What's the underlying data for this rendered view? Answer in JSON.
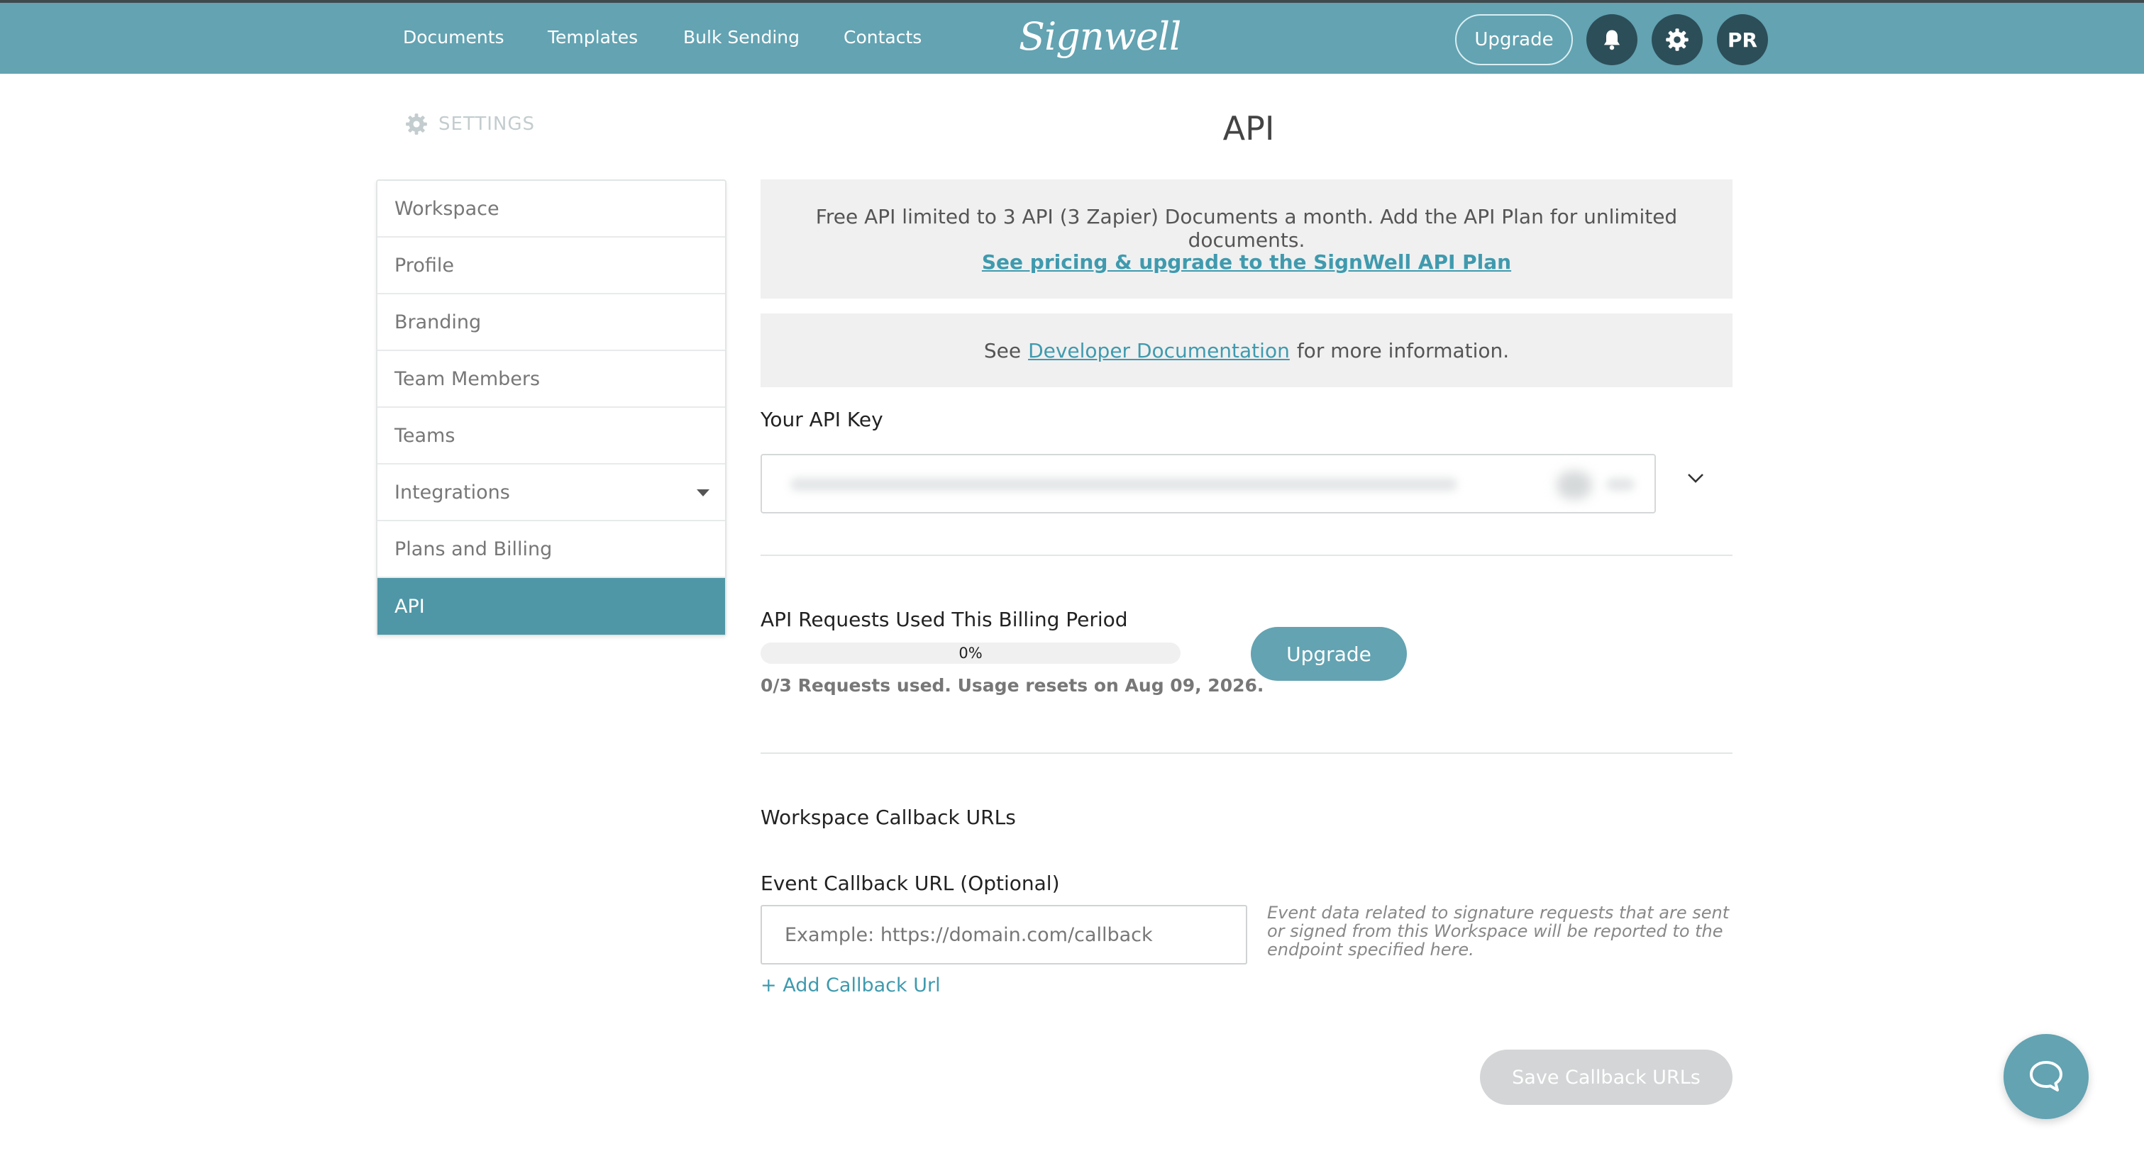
{
  "nav": {
    "links": [
      "Documents",
      "Templates",
      "Bulk Sending",
      "Contacts"
    ],
    "logo": "Signwell",
    "upgrade_label": "Upgrade",
    "avatar_initials": "PR"
  },
  "settings": {
    "heading": "SETTINGS",
    "page_title": "API",
    "sidebar_items": [
      {
        "label": "Workspace"
      },
      {
        "label": "Profile"
      },
      {
        "label": "Branding"
      },
      {
        "label": "Team Members"
      },
      {
        "label": "Teams"
      },
      {
        "label": "Integrations"
      },
      {
        "label": "Plans and Billing"
      },
      {
        "label": "API"
      }
    ],
    "active_item": "API"
  },
  "api": {
    "free_notice": "Free API limited to 3 API (3 Zapier) Documents a month. Add the API Plan for unlimited documents.",
    "pricing_link": "See pricing & upgrade to the SignWell API Plan",
    "docs_prefix": "See",
    "docs_link": "Developer Documentation",
    "docs_suffix": "for more information.",
    "key_label": "Your API Key",
    "requests_label": "API Requests Used This Billing Period",
    "progress_percent": 0,
    "progress_text": "0%",
    "usage_text": "0/3 Requests used. Usage resets on Aug 09, 2026.",
    "upgrade_label": "Upgrade",
    "callbacks_heading": "Workspace Callback URLs",
    "event_label": "Event Callback URL (Optional)",
    "event_placeholder": "Example: https://domain.com/callback",
    "event_help": "Event data related to signature requests that are sent or signed from this Workspace will be reported to the endpoint specified here.",
    "add_callback": "+ Add Callback Url",
    "save_label": "Save Callback URLs"
  },
  "colors": {
    "brand": "#63a3b2",
    "active": "#4f97a6",
    "dark_icon": "#2c4e58",
    "link": "#3f9aae"
  },
  "icons": [
    "bell-icon",
    "gear-icon",
    "chevron-down-icon",
    "chat-icon",
    "caret-down-icon"
  ]
}
